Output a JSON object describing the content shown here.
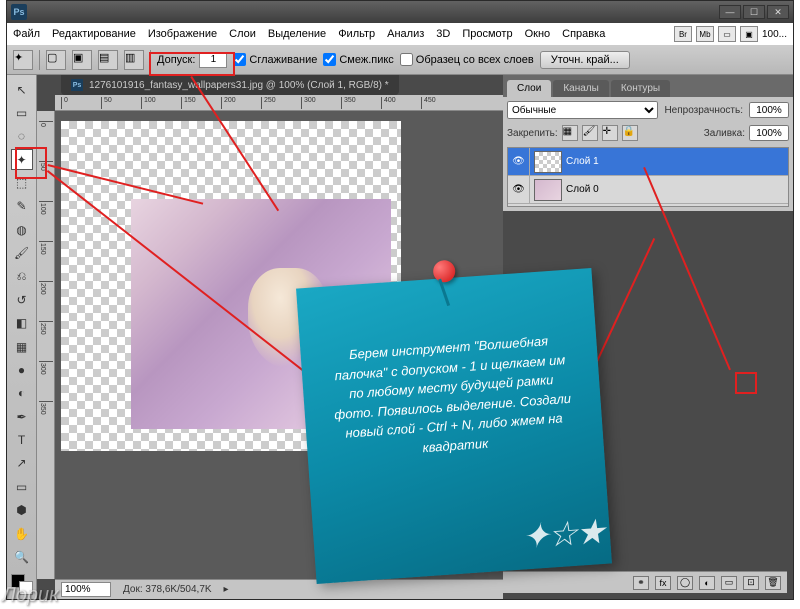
{
  "titlebar": {
    "logo": "Ps"
  },
  "menu": {
    "items": [
      "Файл",
      "Редактирование",
      "Изображение",
      "Слои",
      "Выделение",
      "Фильтр",
      "Анализ",
      "3D",
      "Просмотр",
      "Окно",
      "Справка"
    ],
    "right_icons": [
      "Br",
      "Mb"
    ],
    "zoom_label": "100..."
  },
  "options": {
    "tolerance_label": "Допуск:",
    "tolerance_value": "1",
    "anti_alias": "Сглаживание",
    "contiguous": "Cмеж.пикс",
    "sample_all": "Образец со всех слоев",
    "refine_edge": "Уточн. край..."
  },
  "document": {
    "tab_title": "1276101916_fantasy_wallpapers31.jpg @ 100% (Слой 1, RGB/8) *",
    "zoom": "100%",
    "doc_size": "Док: 378,6K/504,7K"
  },
  "ruler_marks_h": [
    "0",
    "50",
    "100",
    "150",
    "200",
    "250",
    "300",
    "350",
    "400",
    "450"
  ],
  "ruler_marks_v": [
    "0",
    "50",
    "100",
    "150",
    "200",
    "250",
    "300",
    "350"
  ],
  "layers_panel": {
    "tabs": [
      "Слои",
      "Каналы",
      "Контуры"
    ],
    "blend_mode": "Обычные",
    "opacity_label": "Непрозрачность:",
    "opacity": "100%",
    "lock_label": "Закрепить:",
    "fill_label": "Заливка:",
    "fill": "100%",
    "layers": [
      {
        "name": "Слой 1",
        "selected": true,
        "thumb": "checker"
      },
      {
        "name": "Слой 0",
        "selected": false,
        "thumb": "img"
      }
    ],
    "footer_icons": [
      "fx",
      "◯",
      "◐",
      "▭",
      "⊡",
      "🗑"
    ]
  },
  "note_text": "Берем инструмент \"Волшебная палочка\" с допуском - 1 и щелкаем им по любому месту будущей рамки фото. Появилось выделение.  Создали новый слой -  Ctrl + N, либо жмем на квадратик",
  "watermark": "Лорик"
}
